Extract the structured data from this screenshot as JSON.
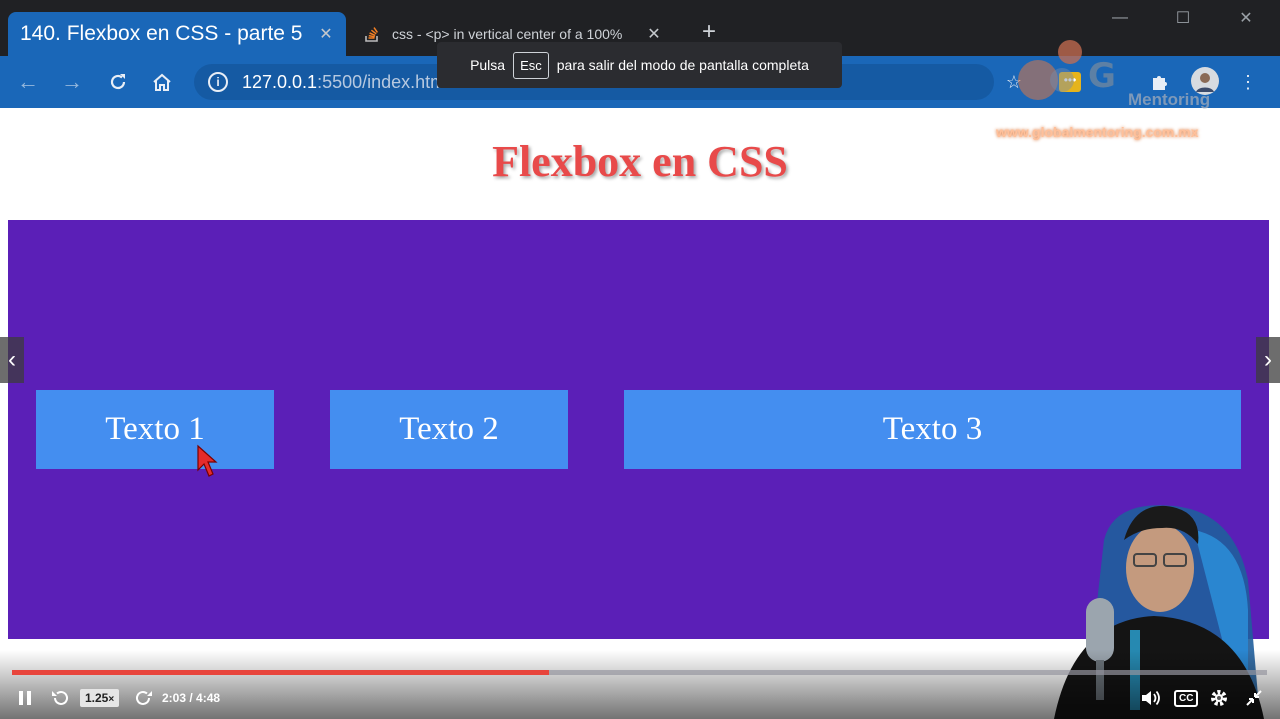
{
  "browser": {
    "tabs": [
      {
        "title": "140. Flexbox en CSS - parte 5",
        "active": true
      },
      {
        "title": "css - <p> in vertical center of a 100%",
        "active": false
      }
    ],
    "address": {
      "host": "127.0.0.1",
      "rest": ":5500/index.html"
    },
    "fullscreen_notice": {
      "before": "Pulsa",
      "key": "Esc",
      "after": "para salir del modo de pantalla completa"
    }
  },
  "watermark": {
    "brand": "G",
    "subtitle": "Mentoring",
    "site": "www.globalmentoring.com.mx"
  },
  "page": {
    "title": "Flexbox en CSS",
    "items": [
      "Texto 1",
      "Texto 2",
      "Texto 3"
    ]
  },
  "video": {
    "progress": 0.428,
    "speed": "1.25",
    "speed_suffix": "×",
    "time": "2:03 / 4:48",
    "cc_label": "CC"
  },
  "colors": {
    "title": "#e84a4a",
    "container": "#5b1fb7",
    "item": "#448ef0",
    "chrome": "#1a67b8",
    "progress": "#e8453c"
  }
}
